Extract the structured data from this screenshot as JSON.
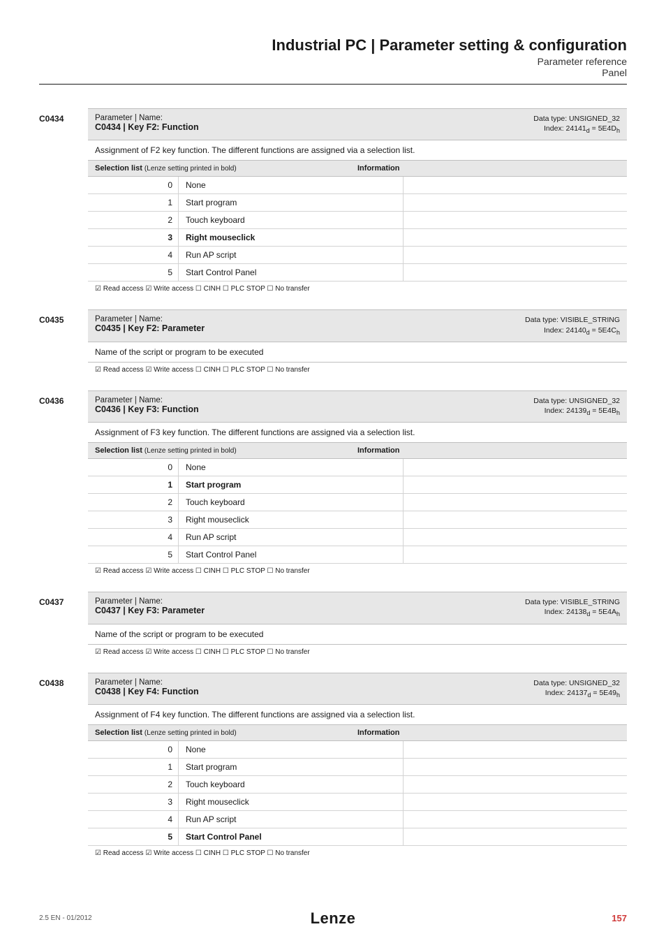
{
  "header": {
    "title": "Industrial PC | Parameter setting & configuration",
    "subtitle1": "Parameter reference",
    "subtitle2": "Panel"
  },
  "blocks": [
    {
      "code": "C0434",
      "param_label": "Parameter | Name:",
      "name": "C0434 | Key F2: Function",
      "dtype": "Data type: UNSIGNED_32",
      "index_prefix": "Index: 24141",
      "index_sub1": "d",
      "index_mid": " = 5E4D",
      "index_sub2": "h",
      "desc": "Assignment of F2 key function. The different functions are assigned via a selection list.",
      "sel_hdr_left_bold": "Selection list ",
      "sel_hdr_left_paren": "(Lenze setting printed in bold)",
      "sel_hdr_right": "Information",
      "options": [
        {
          "num": "0",
          "label": "None",
          "bold": false
        },
        {
          "num": "1",
          "label": "Start program",
          "bold": false
        },
        {
          "num": "2",
          "label": "Touch keyboard",
          "bold": false
        },
        {
          "num": "3",
          "label": "Right mouseclick",
          "bold": true
        },
        {
          "num": "4",
          "label": "Run AP script",
          "bold": false
        },
        {
          "num": "5",
          "label": "Start Control Panel",
          "bold": false
        }
      ],
      "access": "☑ Read access   ☑ Write access   ☐ CINH   ☐ PLC STOP   ☐ No transfer"
    },
    {
      "code": "C0435",
      "param_label": "Parameter | Name:",
      "name": "C0435 | Key F2: Parameter",
      "dtype": "Data type: VISIBLE_STRING",
      "index_prefix": "Index: 24140",
      "index_sub1": "d",
      "index_mid": " = 5E4C",
      "index_sub2": "h",
      "desc": "Name of the script or program to be executed",
      "access": "☑ Read access   ☑ Write access   ☐ CINH   ☐ PLC STOP   ☐ No transfer"
    },
    {
      "code": "C0436",
      "param_label": "Parameter | Name:",
      "name": "C0436 | Key F3: Function",
      "dtype": "Data type: UNSIGNED_32",
      "index_prefix": "Index: 24139",
      "index_sub1": "d",
      "index_mid": " = 5E4B",
      "index_sub2": "h",
      "desc": "Assignment of F3 key function. The different functions are assigned via a selection list.",
      "sel_hdr_left_bold": "Selection list ",
      "sel_hdr_left_paren": "(Lenze setting printed in bold)",
      "sel_hdr_right": "Information",
      "options": [
        {
          "num": "0",
          "label": "None",
          "bold": false
        },
        {
          "num": "1",
          "label": "Start program",
          "bold": true
        },
        {
          "num": "2",
          "label": "Touch keyboard",
          "bold": false
        },
        {
          "num": "3",
          "label": "Right mouseclick",
          "bold": false
        },
        {
          "num": "4",
          "label": "Run AP script",
          "bold": false
        },
        {
          "num": "5",
          "label": "Start Control Panel",
          "bold": false
        }
      ],
      "access": "☑ Read access   ☑ Write access   ☐ CINH   ☐ PLC STOP   ☐ No transfer"
    },
    {
      "code": "C0437",
      "param_label": "Parameter | Name:",
      "name": "C0437 | Key F3: Parameter",
      "dtype": "Data type: VISIBLE_STRING",
      "index_prefix": "Index: 24138",
      "index_sub1": "d",
      "index_mid": " = 5E4A",
      "index_sub2": "h",
      "desc": "Name of the script or program to be executed",
      "access": "☑ Read access   ☑ Write access   ☐ CINH   ☐ PLC STOP   ☐ No transfer"
    },
    {
      "code": "C0438",
      "param_label": "Parameter | Name:",
      "name": "C0438 | Key F4: Function",
      "dtype": "Data type: UNSIGNED_32",
      "index_prefix": "Index: 24137",
      "index_sub1": "d",
      "index_mid": " = 5E49",
      "index_sub2": "h",
      "desc": "Assignment of F4 key function. The different functions are assigned via a selection list.",
      "sel_hdr_left_bold": "Selection list ",
      "sel_hdr_left_paren": "(Lenze setting printed in bold)",
      "sel_hdr_right": "Information",
      "options": [
        {
          "num": "0",
          "label": "None",
          "bold": false
        },
        {
          "num": "1",
          "label": "Start program",
          "bold": false
        },
        {
          "num": "2",
          "label": "Touch keyboard",
          "bold": false
        },
        {
          "num": "3",
          "label": "Right mouseclick",
          "bold": false
        },
        {
          "num": "4",
          "label": "Run AP script",
          "bold": false
        },
        {
          "num": "5",
          "label": "Start Control Panel",
          "bold": true
        }
      ],
      "access": "☑ Read access   ☑ Write access   ☐ CINH   ☐ PLC STOP   ☐ No transfer"
    }
  ],
  "footer": {
    "left": "2.5 EN - 01/2012",
    "logo": "Lenze",
    "right": "157"
  }
}
